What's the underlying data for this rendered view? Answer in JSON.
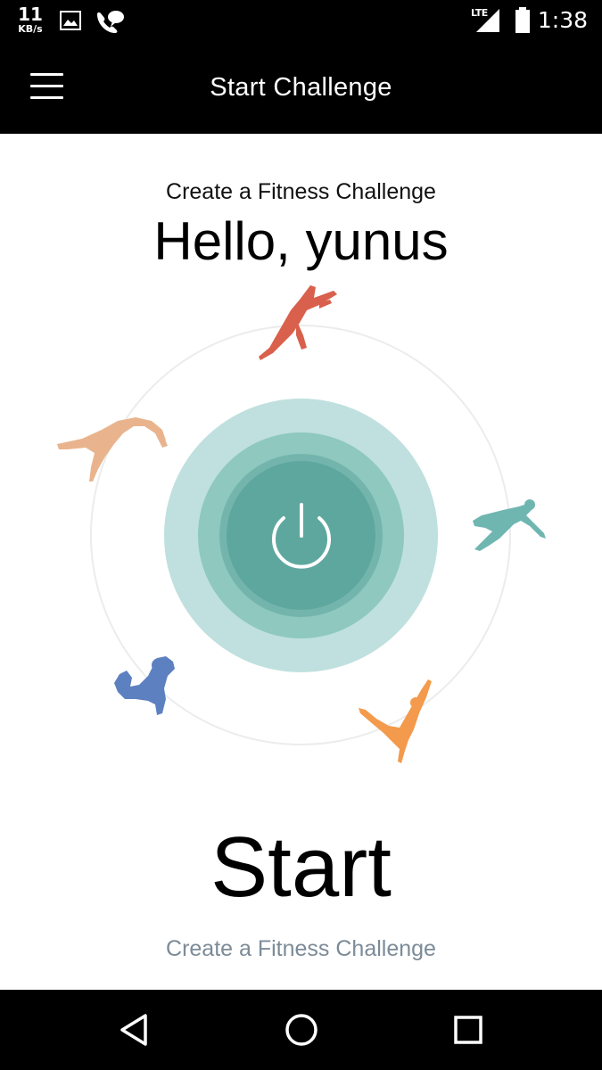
{
  "status_bar": {
    "net_speed_value": "11",
    "net_speed_unit": "KB/s",
    "network_type": "LTE",
    "time": "1:38",
    "icons": [
      "image-icon",
      "chat-icon",
      "signal-icon",
      "battery-icon"
    ]
  },
  "app_bar": {
    "title": "Start Challenge",
    "menu_icon": "hamburger-menu-icon"
  },
  "main": {
    "subtitle": "Create a Fitness Challenge",
    "greeting": "Hello, yunus",
    "power_icon": "power-icon",
    "start_label": "Start",
    "start_caption": "Create a Fitness Challenge",
    "exercise_figures": [
      {
        "name": "yoga-stretch-figure",
        "color": "#d9604c"
      },
      {
        "name": "backbend-figure",
        "color": "#e9b48d"
      },
      {
        "name": "lunge-figure",
        "color": "#6fb6b1"
      },
      {
        "name": "jump-figure",
        "color": "#f49a4c"
      },
      {
        "name": "crouch-figure",
        "color": "#5d80c0"
      }
    ]
  },
  "nav_bar": {
    "back_icon": "back-triangle-icon",
    "home_icon": "home-circle-icon",
    "recents_icon": "recents-square-icon"
  },
  "colors": {
    "ring_outer": "#bfe0de",
    "ring_mid": "#8ec8bf",
    "ring_inner": "#5ea79e",
    "caption": "#7c8b98"
  }
}
